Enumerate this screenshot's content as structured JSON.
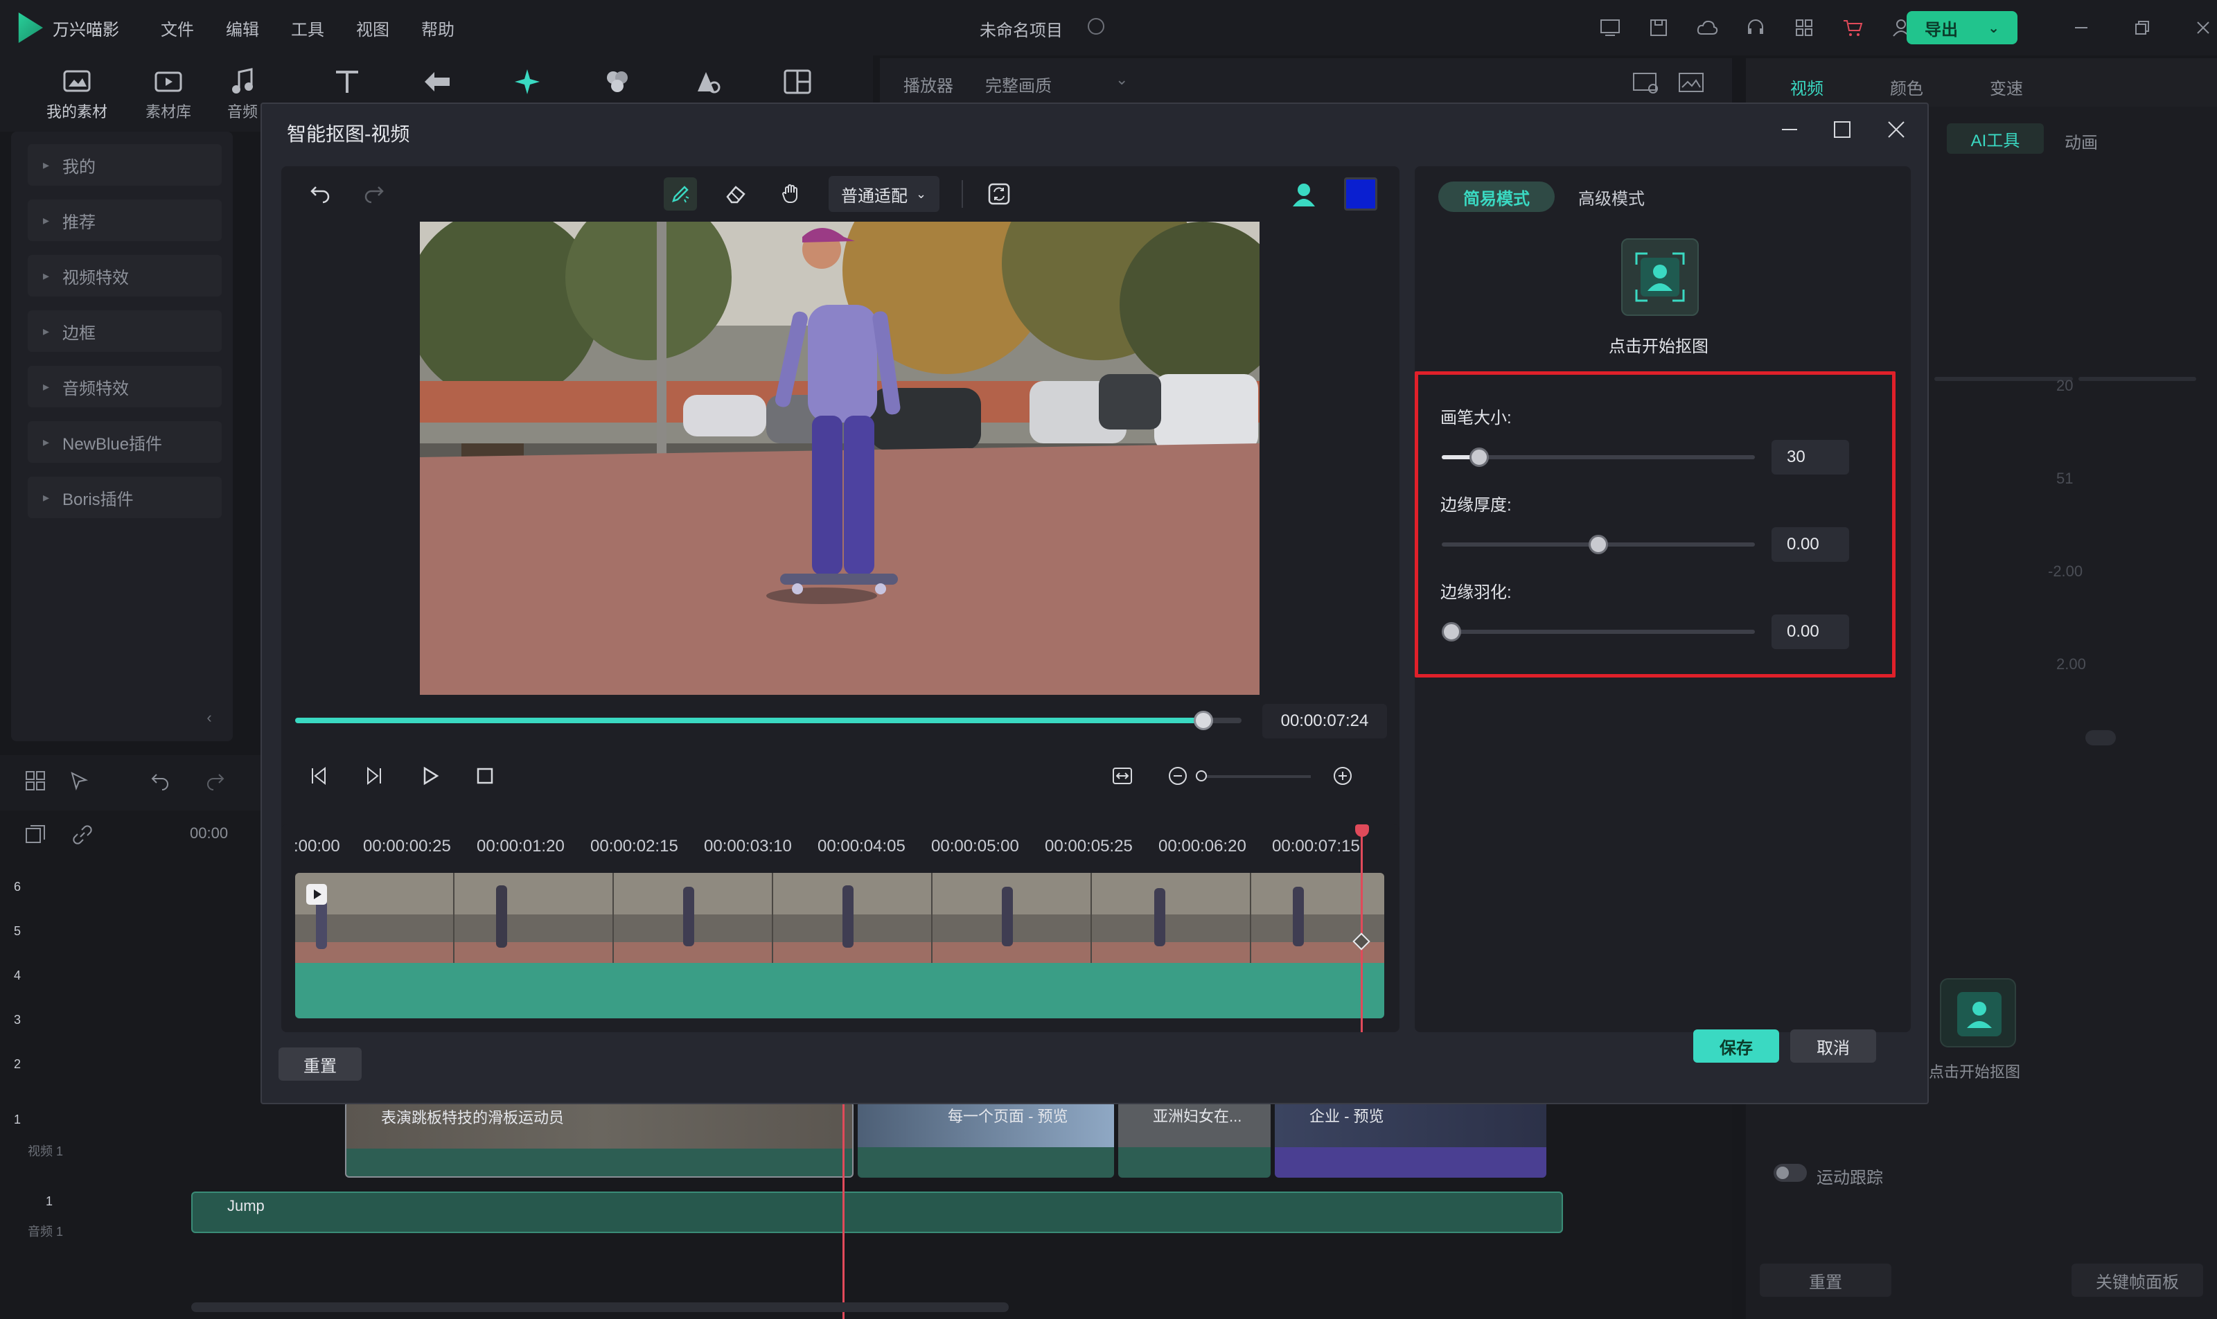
{
  "app": {
    "name": "万兴喵影",
    "project_title": "未命名项目",
    "export_label": "导出"
  },
  "menu": [
    "文件",
    "编辑",
    "工具",
    "视图",
    "帮助"
  ],
  "toolbar": {
    "my_assets": "我的素材",
    "library": "素材库",
    "audio": "音频"
  },
  "preview": {
    "player_label": "播放器",
    "quality": "完整画质"
  },
  "right_tabs": {
    "video": "视频",
    "color": "颜色",
    "speed": "变速",
    "ai_tools": "AI工具",
    "animation": "动画"
  },
  "right_panel": {
    "values": [
      "20",
      "51",
      "-2.00",
      "2.00"
    ],
    "cutout_label": "点击开始抠图",
    "motion_tracking": "运动跟踪",
    "reset": "重置",
    "keyframe_panel": "关键帧面板"
  },
  "left_panel": {
    "items": [
      "我的",
      "推荐",
      "视频特效",
      "边框",
      "音频特效",
      "NewBlue插件",
      "Boris插件"
    ]
  },
  "timeline": {
    "ruler_start": "00:00",
    "track_nums": [
      "6",
      "5",
      "4",
      "3",
      "2",
      "1"
    ],
    "video_track_label": "视频 1",
    "audio_track_num": "1",
    "audio_track_label": "音频 1",
    "clips": [
      "表演跳板特技的滑板运动员",
      "每一个页面 - 预览",
      "亚洲妇女在...",
      "企业 - 预览"
    ],
    "audio_clip": "Jump"
  },
  "dialog": {
    "title": "智能抠图-视频",
    "fit_mode": "普通适配",
    "timecode": "00:00:07:24",
    "progress": 0.96,
    "ruler": [
      ":00:00",
      "00:00:00:25",
      "00:00:01:20",
      "00:00:02:15",
      "00:00:03:10",
      "00:00:04:05",
      "00:00:05:00",
      "00:00:05:25",
      "00:00:06:20",
      "00:00:07:15"
    ],
    "reset": "重置",
    "save": "保存",
    "cancel": "取消",
    "mode_simple": "简易模式",
    "mode_advanced": "高级模式",
    "start_cutout": "点击开始抠图",
    "brush_size_label": "画笔大小:",
    "brush_size_value": "30",
    "edge_thickness_label": "边缘厚度:",
    "edge_thickness_value": "0.00",
    "edge_feather_label": "边缘羽化:",
    "edge_feather_value": "0.00",
    "slider_levels": {
      "brush_size": 0.12,
      "edge_thickness": 0.5,
      "edge_feather": 0.03
    },
    "colors": {
      "accent": "#3ad9c2",
      "save_bg": "#3ad9c2",
      "highlight_border": "#e0202a",
      "swatch": "#0a1fd0"
    }
  }
}
